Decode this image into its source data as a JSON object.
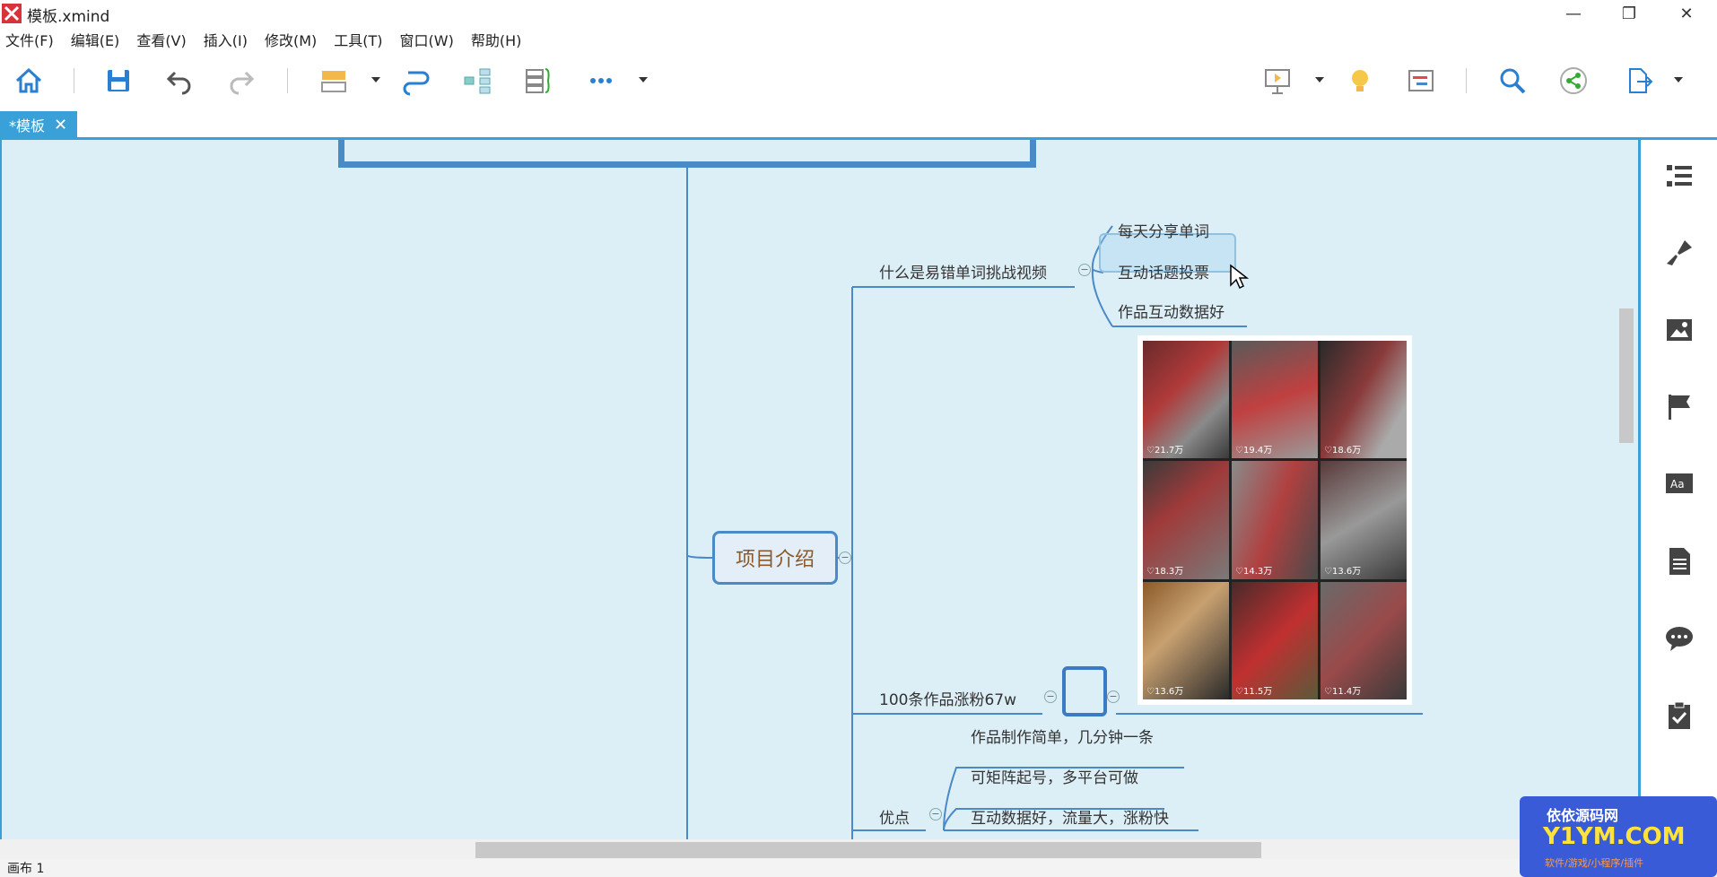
{
  "window": {
    "title": "模板.xmind",
    "minimize": "—",
    "restore": "❐",
    "close": "✕"
  },
  "menu": [
    "文件(F)",
    "编辑(E)",
    "查看(V)",
    "插入(I)",
    "修改(M)",
    "工具(T)",
    "窗口(W)",
    "帮助(H)"
  ],
  "toolbar": {
    "icons": [
      "home-icon",
      "save-icon",
      "undo-icon",
      "redo-icon",
      "topic-icon",
      "relationship-icon",
      "structure-icon",
      "boundary-icon",
      "more-icon",
      "presentation-icon",
      "idea-icon",
      "gantt-icon",
      "search-icon",
      "share-icon",
      "export-icon"
    ]
  },
  "tab": {
    "label": "*模板",
    "close": "✕"
  },
  "mindmap": {
    "central": "项目介绍",
    "branch1": {
      "label": "什么是易错单词挑战视频",
      "children": [
        "每天分享单词",
        "互动话题投票",
        "作品互动数据好"
      ]
    },
    "branch2": {
      "label": "100条作品涨粉67w"
    },
    "branch3": {
      "label": "优点",
      "children": [
        "作品制作简单，几分钟一条",
        "可矩阵起号，多平台可做",
        "互动数据好，流量大，涨粉快"
      ]
    },
    "image_likes": [
      "21.7万",
      "19.4万",
      "18.6万",
      "18.3万",
      "14.3万",
      "13.6万",
      "13.6万",
      "11.5万",
      "11.4万"
    ]
  },
  "statusbar": {
    "sheet": "画布 1"
  },
  "right_panel": {
    "icons": [
      "outline-icon",
      "format-icon",
      "image-icon",
      "marker-icon",
      "text-icon",
      "notes-icon",
      "comment-icon",
      "task-icon"
    ]
  },
  "watermark": {
    "line1": "依依源码网",
    "line2": "Y1YM.COM",
    "line3": "软件/游戏/小程序/插件"
  },
  "colors": {
    "accent": "#39a0d8",
    "canvas": "#dceef6",
    "branch": "#4b8ac8"
  }
}
